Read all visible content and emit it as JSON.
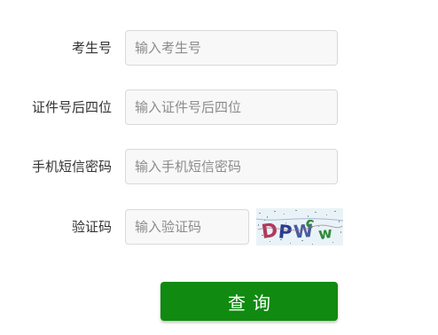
{
  "form": {
    "fields": [
      {
        "label": "考生号",
        "placeholder": "输入考生号"
      },
      {
        "label": "证件号后四位",
        "placeholder": "输入证件号后四位"
      },
      {
        "label": "手机短信密码",
        "placeholder": "输入手机短信密码"
      },
      {
        "label": "验证码",
        "placeholder": "输入验证码"
      }
    ],
    "captcha_text": "DPWcw",
    "submit_label": "查询"
  },
  "colors": {
    "button_bg": "#118a11",
    "input_bg": "#f8f8f8",
    "input_border": "#d9d9d9"
  }
}
